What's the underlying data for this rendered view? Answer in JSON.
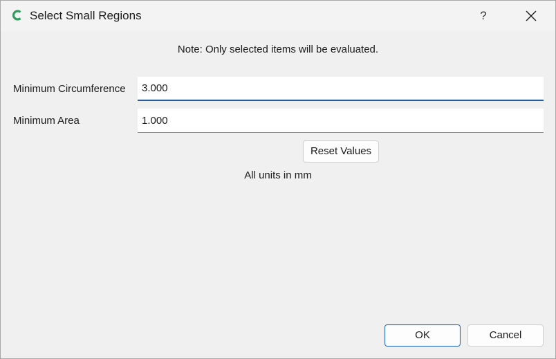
{
  "window": {
    "title": "Select Small Regions",
    "help_label": "?"
  },
  "colors": {
    "app_icon": "#2e9e5a",
    "focus_accent": "#1f5fa8"
  },
  "icons": {
    "app": "cura-logo-icon",
    "close": "close-icon"
  },
  "note": "Note: Only selected items will be evaluated.",
  "fields": {
    "circumference": {
      "label": "Minimum Circumference",
      "value": "3.000"
    },
    "area": {
      "label": "Minimum Area",
      "value": "1.000"
    }
  },
  "reset_label": "Reset Values",
  "units_text": "All units in mm",
  "footer": {
    "ok_label": "OK",
    "cancel_label": "Cancel"
  }
}
